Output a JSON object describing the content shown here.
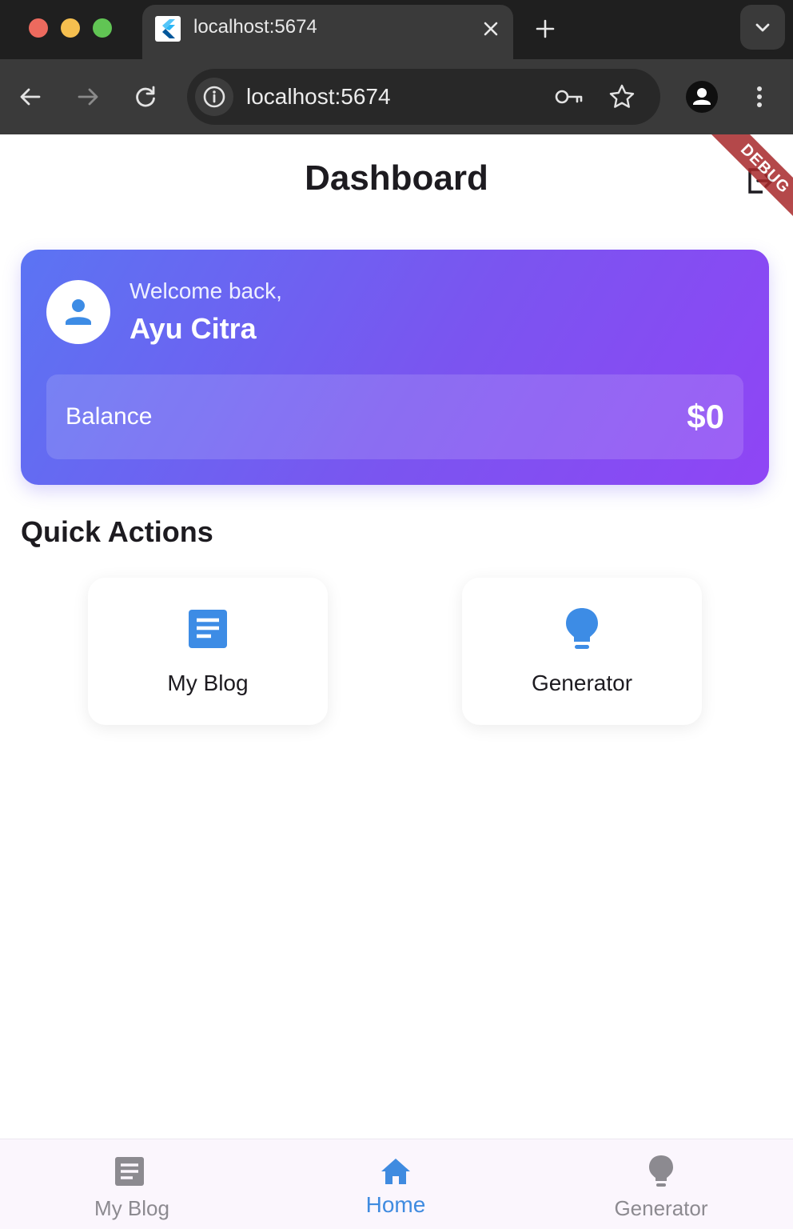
{
  "browser": {
    "tab_title": "localhost:5674",
    "url": "localhost:5674",
    "icons": {
      "favicon": "flutter-logo-icon",
      "close": "close-icon",
      "new_tab": "plus-icon",
      "tab_menu": "chevron-down-icon",
      "back": "arrow-left-icon",
      "forward": "arrow-right-icon",
      "reload": "reload-icon",
      "info": "info-icon",
      "key": "key-icon",
      "bookmark": "star-icon",
      "profile": "profile-icon",
      "menu": "more-vert-icon"
    }
  },
  "app": {
    "title": "Dashboard",
    "debug_banner": "DEBUG",
    "welcome_card": {
      "greeting": "Welcome back,",
      "user_name": "Ayu Citra",
      "balance_label": "Balance",
      "balance_value": "$0",
      "colors": {
        "gradient_start": "#5b74f3",
        "gradient_end": "#8f45f5"
      }
    },
    "quick_actions": {
      "title": "Quick Actions",
      "items": [
        {
          "label": "My Blog",
          "icon": "article-icon"
        },
        {
          "label": "Generator",
          "icon": "lightbulb-icon"
        }
      ]
    },
    "bottom_nav": {
      "items": [
        {
          "label": "My Blog",
          "icon": "article-icon",
          "active": false
        },
        {
          "label": "Home",
          "icon": "home-icon",
          "active": true
        },
        {
          "label": "Generator",
          "icon": "lightbulb-icon",
          "active": false
        }
      ]
    },
    "colors": {
      "accent": "#3f8be0",
      "inactive": "#8c8a90",
      "nav_background": "#fbf6fd"
    }
  }
}
